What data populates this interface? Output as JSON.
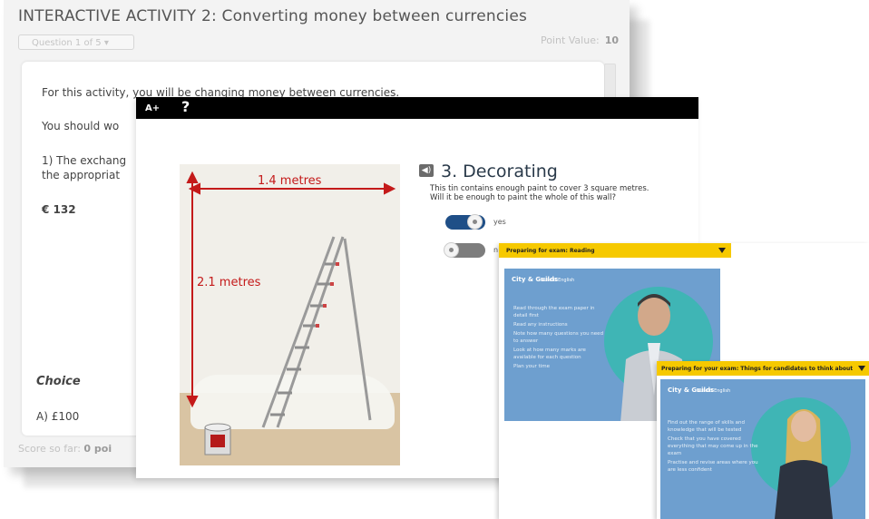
{
  "quiz": {
    "title": "INTERACTIVE ACTIVITY 2: Converting money between currencies",
    "question_select": "Question 1 of 5",
    "point_value_label": "Point Value:",
    "point_value": "10",
    "paragraph1": "For this activity, you will be changing money between currencies.",
    "paragraph2": "You should wo",
    "paragraph3a": "1) The exchang",
    "paragraph3b": "the appropriat",
    "amount": "€ 132",
    "choice_heading": "Choice",
    "choice_a": "A) £100",
    "score_label": "Score so far:",
    "score_value": "0 poi"
  },
  "decorating": {
    "font_size_button": "A",
    "font_size_plus": "A+",
    "help_button": "?",
    "heading": "3. Decorating",
    "question_line1": "This tin contains enough paint to cover 3 square metres.",
    "question_line2": "Will it be enough to paint the whole of this wall?",
    "option_yes": "yes",
    "option_no": "n",
    "width_label": "1.4 metres",
    "height_label": "2.1 metres"
  },
  "video1": {
    "title": "Preparing for exam: Reading",
    "logo": "City & Guilds",
    "logo_sub": "Build it English",
    "bullets": [
      "Read through the exam paper in detail first",
      "Read any instructions",
      "Note how many questions you need to answer",
      "Look at how many marks are available for each question",
      "Plan your time"
    ]
  },
  "video2": {
    "title": "Preparing for your exam: Things for candidates to think about",
    "logo": "City & Guilds",
    "logo_sub": "Build it English",
    "bullets": [
      "Find out the range of skills and knowledge that will be tested",
      "Check that you have covered everything that may come up in the exam",
      "Practise and revise areas where you are less confident"
    ]
  },
  "colors": {
    "toggle_on": "#1f4f87",
    "toggle_off": "#7d7d7d",
    "accent_yellow": "#f6c900",
    "dimension_red": "#c41a1a"
  }
}
